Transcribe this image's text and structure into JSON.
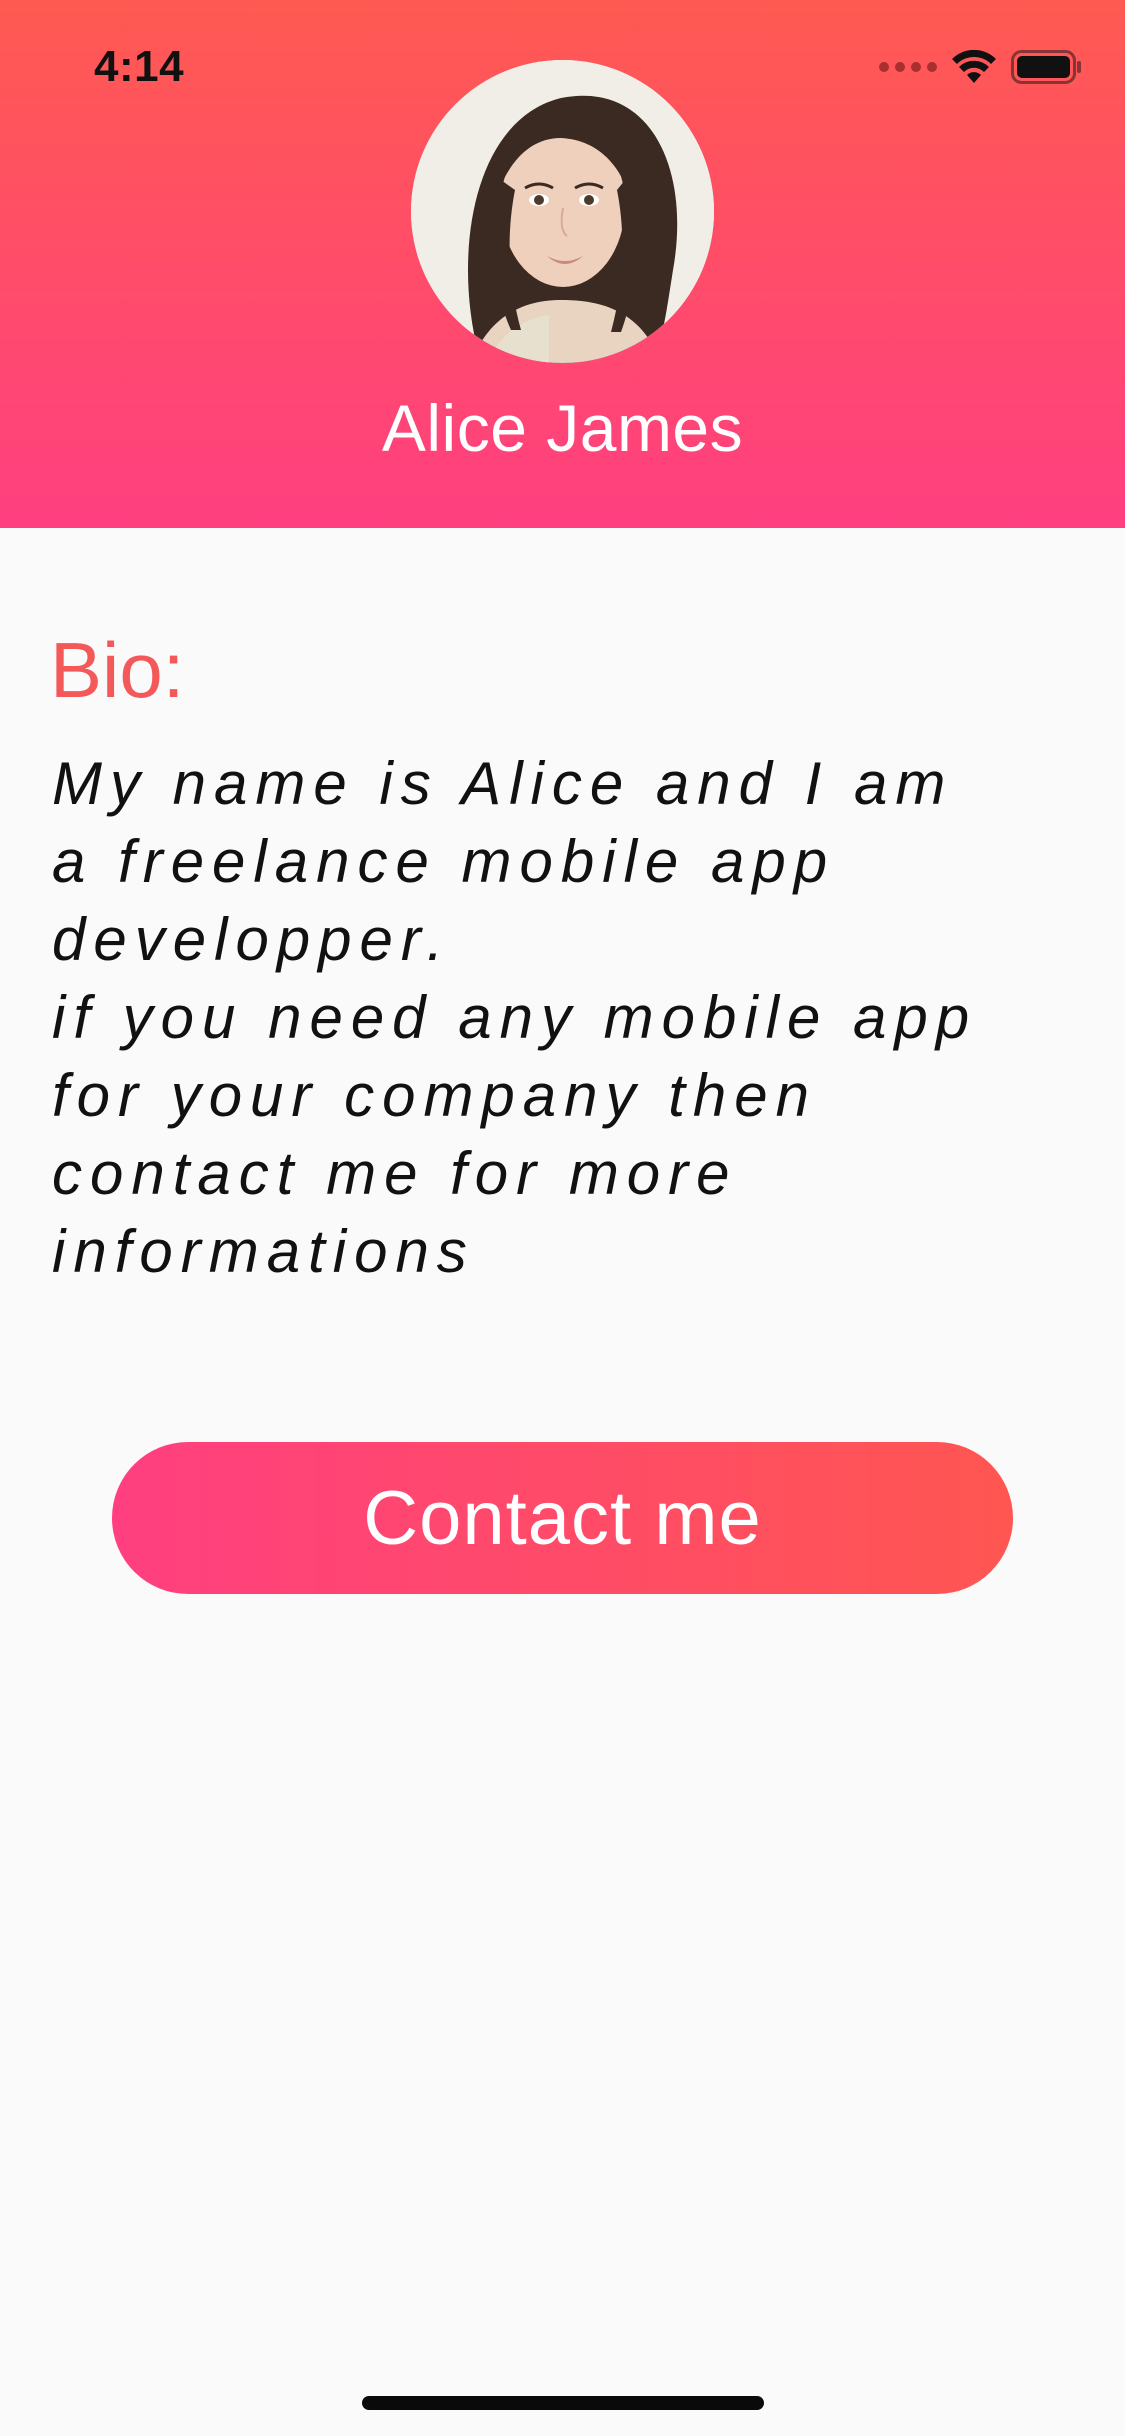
{
  "status_bar": {
    "time": "4:14",
    "icons": [
      "signal-icon",
      "wifi-icon",
      "battery-icon"
    ]
  },
  "profile": {
    "name": "Alice James",
    "avatar_icon": "avatar-photo"
  },
  "bio": {
    "label": "Bio:",
    "text": "My name is Alice and I am\na freelance mobile app\ndevelopper.\nif you need any mobile app\nfor your company then\ncontact me for more\ninformations"
  },
  "actions": {
    "contact_label": "Contact me"
  },
  "colors": {
    "header_top": "#ff5a52",
    "header_bottom": "#ff3f80",
    "accent": "#f4595a",
    "background": "#fafafa"
  }
}
